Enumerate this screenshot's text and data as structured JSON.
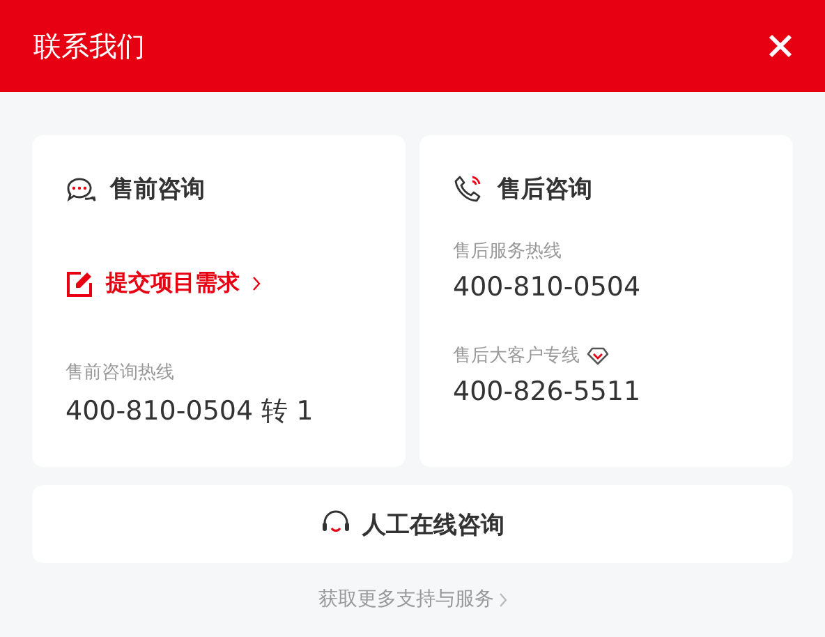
{
  "window": {
    "title": "联系我们"
  },
  "presales": {
    "title": "售前咨询",
    "link": "提交项目需求",
    "hotline_label": "售前咨询热线",
    "hotline": "400-810-0504 转 1"
  },
  "aftersales": {
    "title": "售后咨询",
    "lines": [
      {
        "label": "售后服务热线",
        "number": "400-810-0504",
        "vip": false
      },
      {
        "label": "售后大客户专线",
        "number": "400-826-5511",
        "vip": true
      }
    ]
  },
  "online_button": "人工在线咨询",
  "footer_link": "获取更多支持与服务"
}
